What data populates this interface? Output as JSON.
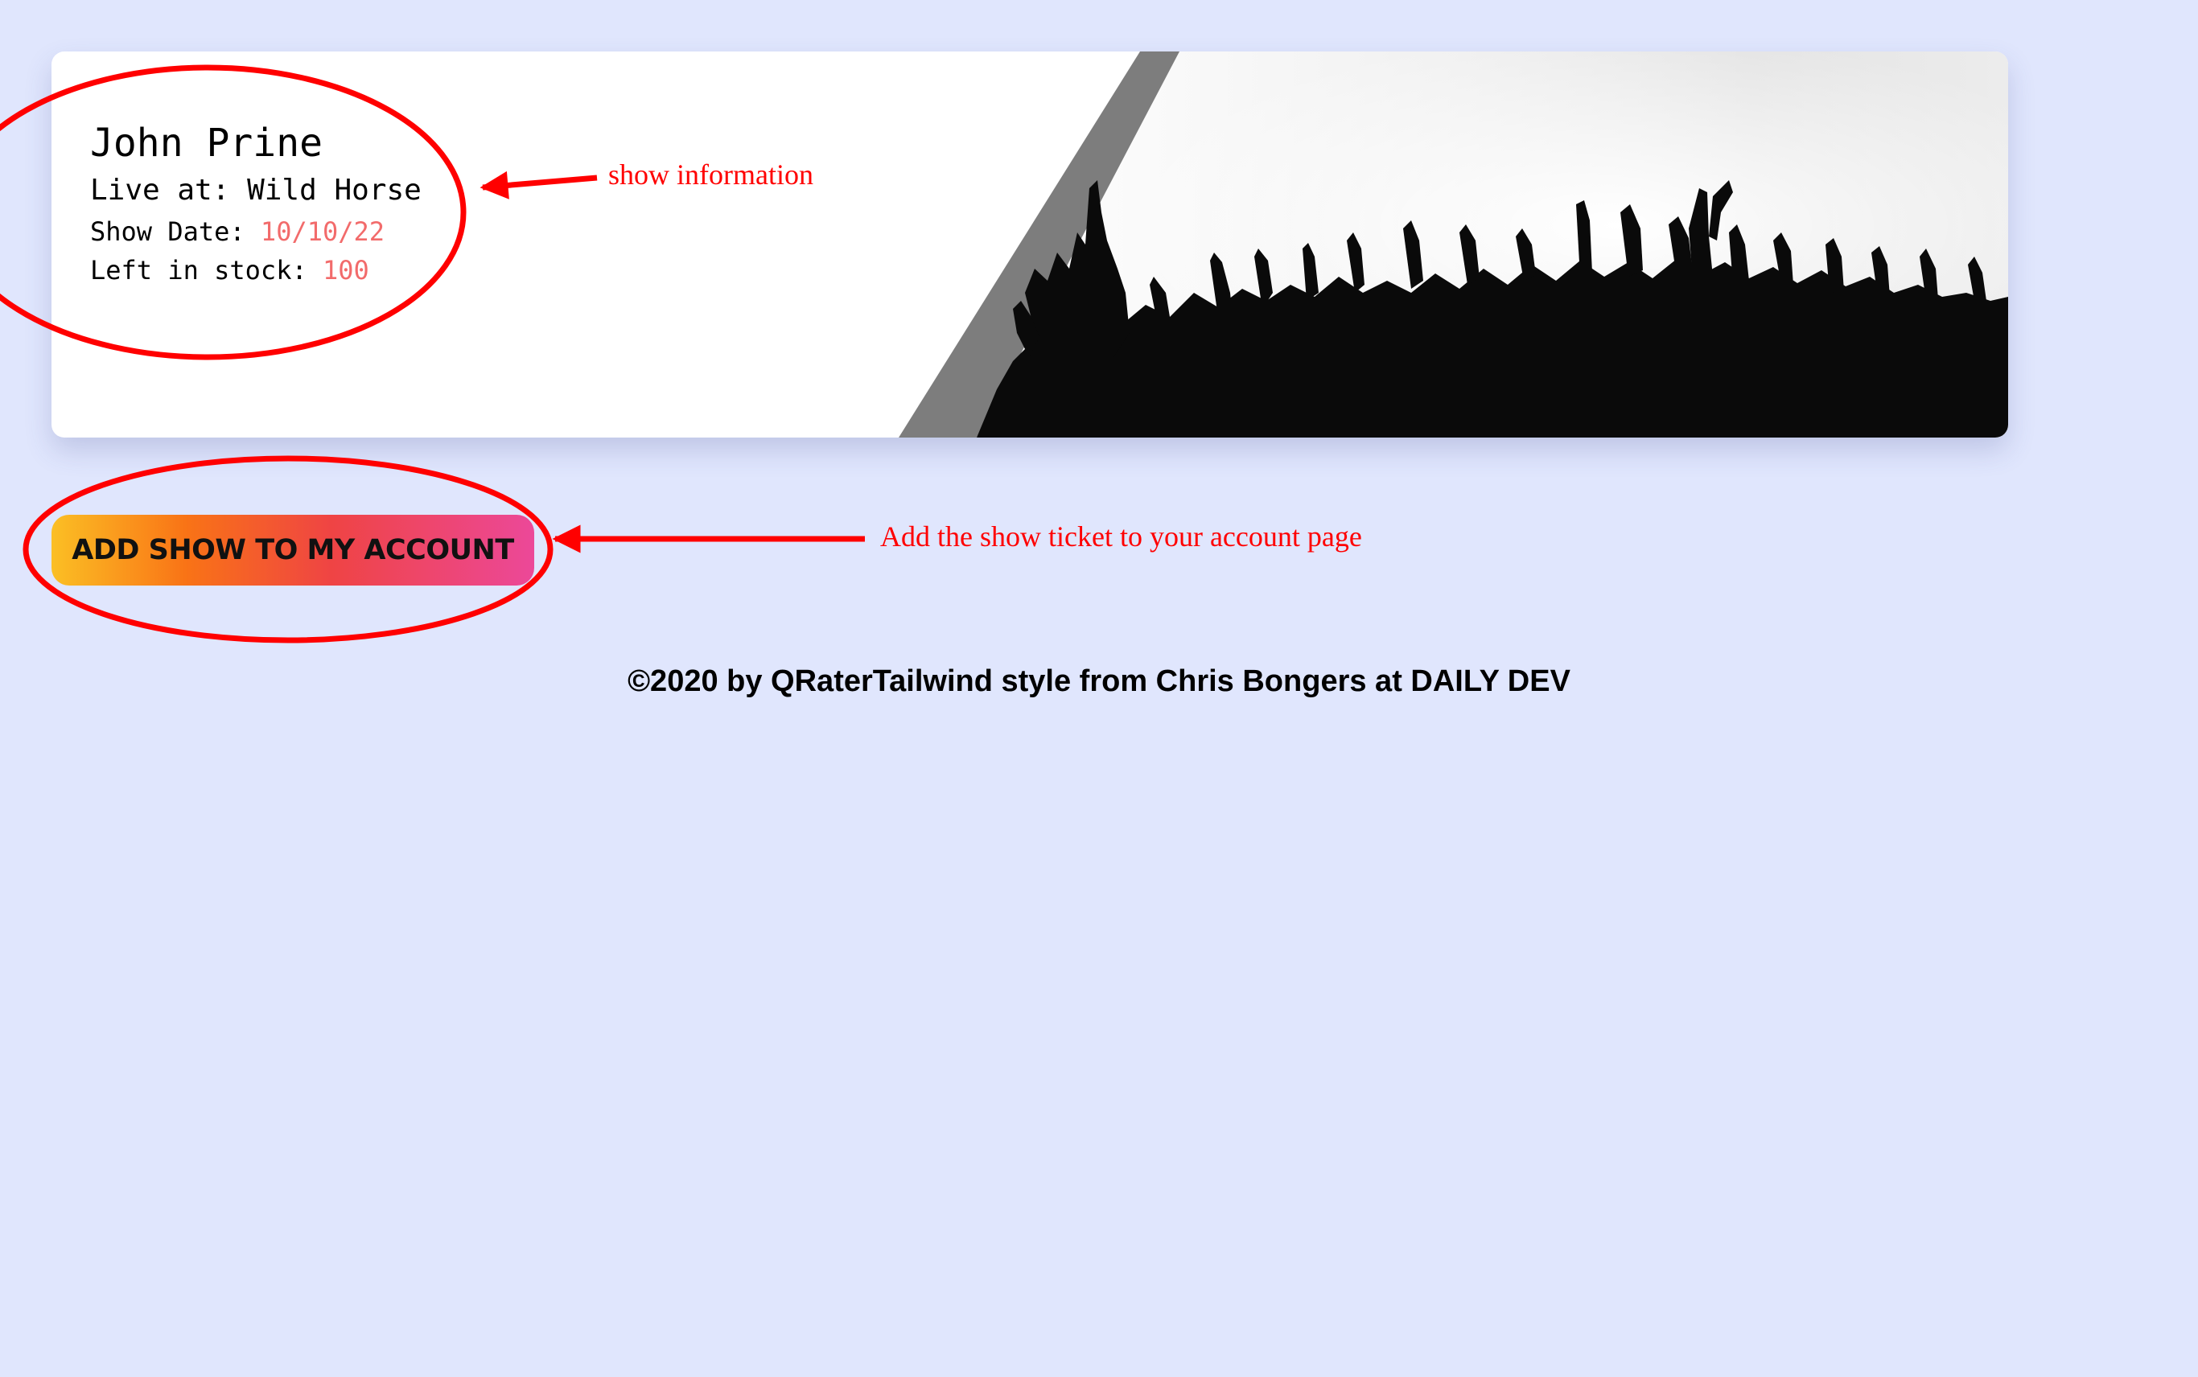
{
  "show": {
    "artist": "John Prine",
    "venue_label": "Live at:",
    "venue": "Wild Horse",
    "date_label": "Show Date:",
    "date": "10/10/22",
    "stock_label": "Left in stock:",
    "stock": "100"
  },
  "actions": {
    "add_show_label": "ADD SHOW TO MY ACCOUNT"
  },
  "footer": {
    "text": "©2020 by QRaterTailwind style from Chris Bongers at DAILY DEV"
  },
  "annotations": {
    "show_info": "show information",
    "add_ticket": "Add the show ticket to your account page"
  },
  "colors": {
    "page_background": "#e0e6fd",
    "accent": "#f26b6b",
    "annotation": "#ff0000",
    "button_gradient": [
      "#fbbf24",
      "#f97316",
      "#ef4444",
      "#ec4899"
    ]
  }
}
